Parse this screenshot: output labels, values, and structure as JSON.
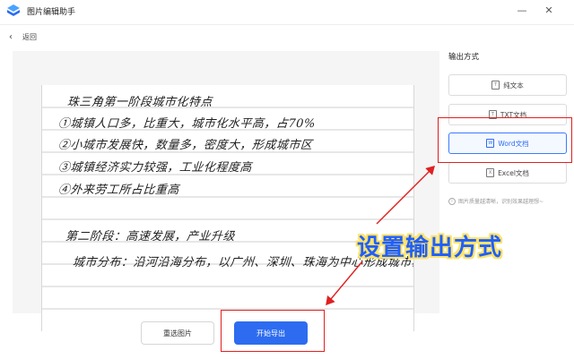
{
  "window": {
    "title": "图片编辑助手",
    "minimize": "—",
    "close": "✕"
  },
  "nav": {
    "back_label": "返回"
  },
  "preview": {
    "handwriting_lines": [
      "珠三角第一阶段城市化特点",
      "①城镇人口多，比重大，城市化水平高，占70%",
      "②小城市发展快，数量多，密度大，形成城市区",
      "③城镇经济实力较强，工业化程度高",
      "④外来劳工所占比重高",
      "第二阶段：高速发展，产业升级",
      "城市分布：沿河沿海分布，以广州、深圳、珠海为中心形成城市群"
    ]
  },
  "output_panel": {
    "title": "输出方式",
    "options": [
      {
        "label": "纯文本",
        "icon": "text-icon",
        "selected": false
      },
      {
        "label": "TXT文档",
        "icon": "txt-file-icon",
        "selected": false
      },
      {
        "label": "Word文档",
        "icon": "word-file-icon",
        "selected": true
      },
      {
        "label": "Excel文档",
        "icon": "excel-file-icon",
        "selected": false
      }
    ],
    "hint": "图片质量越清晰，识别效果越理想~"
  },
  "actions": {
    "reselect_label": "重选图片",
    "export_label": "开始导出"
  },
  "annotation": {
    "text": "设置输出方式"
  },
  "colors": {
    "accent": "#2d6cf0",
    "highlight": "#e02020",
    "annotation_text": "#1f5fff",
    "annotation_outline": "#ffe36a"
  }
}
